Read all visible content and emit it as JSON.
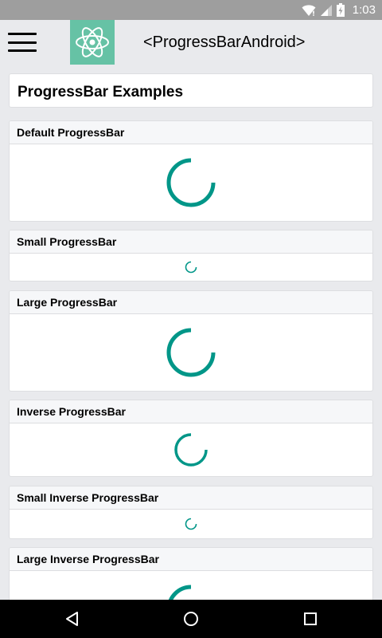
{
  "status_bar": {
    "time": "1:03",
    "icons": [
      "wifi-icon",
      "cell-signal-icon",
      "battery-charging-icon"
    ]
  },
  "app_bar": {
    "menu_icon": "hamburger-menu-icon",
    "logo_icon": "react-atom-icon",
    "title": "<ProgressBarAndroid>",
    "logo_color": "#66c2a5"
  },
  "content": {
    "header_title": "ProgressBar Examples",
    "sections": [
      {
        "label": "Default ProgressBar",
        "size": "default"
      },
      {
        "label": "Small ProgressBar",
        "size": "small"
      },
      {
        "label": "Large ProgressBar",
        "size": "large"
      },
      {
        "label": "Inverse ProgressBar",
        "size": "inverse"
      },
      {
        "label": "Small Inverse ProgressBar",
        "size": "small"
      },
      {
        "label": "Large Inverse ProgressBar",
        "size": "large"
      }
    ],
    "spinner_color": "#009688"
  },
  "nav_bar": {
    "icons": [
      "back-icon",
      "home-icon",
      "recents-icon"
    ]
  }
}
